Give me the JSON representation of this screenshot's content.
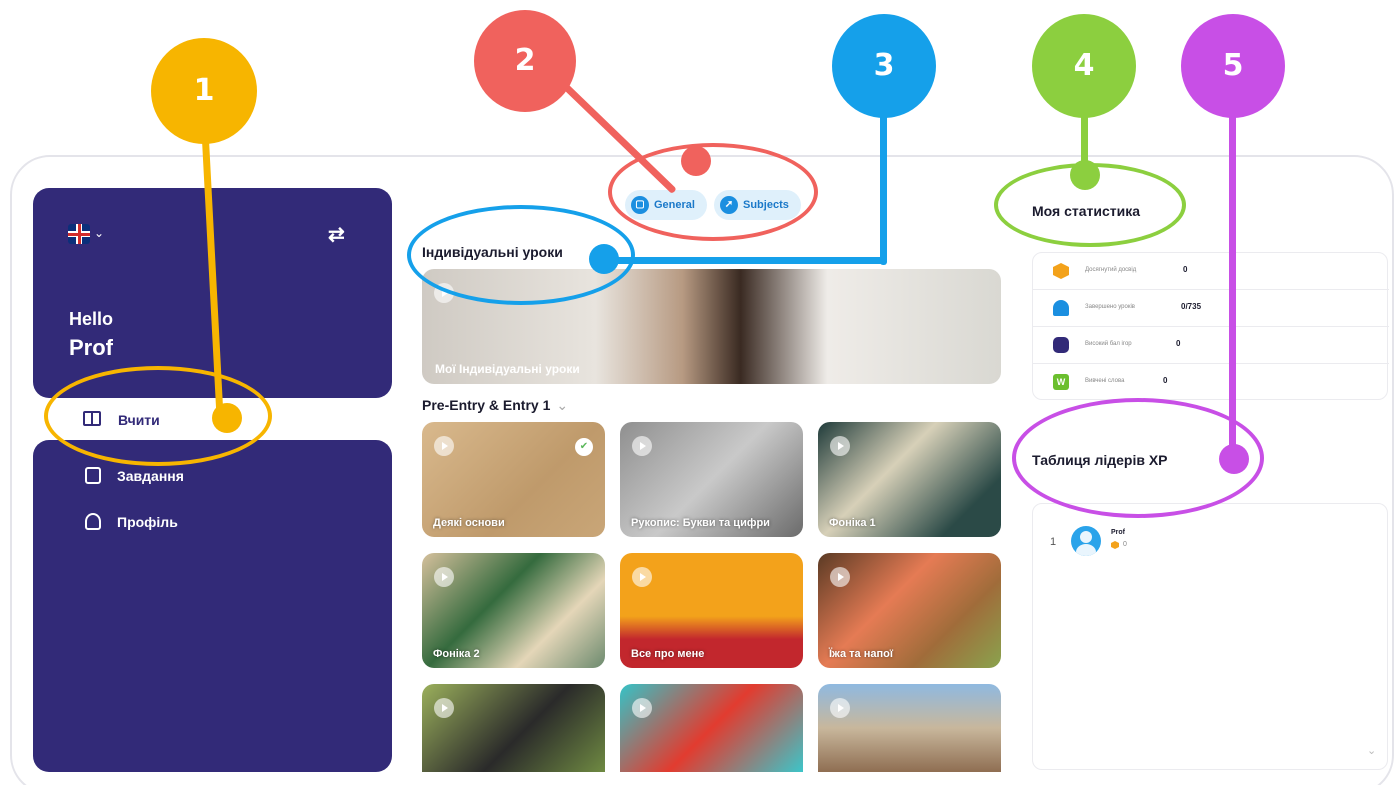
{
  "sidebar": {
    "hello": "Hello",
    "user_name": "Prof",
    "nav": [
      {
        "label": "Вчити",
        "active": true
      },
      {
        "label": "Завдання",
        "active": false
      },
      {
        "label": "Профіль",
        "active": false
      }
    ],
    "language_icon": "uk-flag-icon",
    "swap_icon": "swap-arrows-icon"
  },
  "tabs": [
    {
      "label": "General",
      "icon": "book-icon"
    },
    {
      "label": "Subjects",
      "icon": "rocket-icon"
    }
  ],
  "main": {
    "individual_title": "Індивідуальні уроки",
    "hero_label": "Мої Індивідуальні уроки",
    "level_title": "Pre-Entry & Entry 1",
    "lessons": [
      {
        "label": "Деякі основи",
        "completed": true
      },
      {
        "label": "Рукопис: Букви та цифри",
        "completed": false
      },
      {
        "label": "Фоніка 1",
        "completed": false
      },
      {
        "label": "Фоніка 2",
        "completed": false
      },
      {
        "label": "Все про мене",
        "completed": false
      },
      {
        "label": "Їжа та напої",
        "completed": false
      },
      {
        "label": "",
        "completed": false
      },
      {
        "label": "",
        "completed": false
      },
      {
        "label": "",
        "completed": false
      }
    ]
  },
  "stats": {
    "title": "Моя статистика",
    "rows": [
      {
        "icon": "xp-hexagon-icon",
        "label": "Досягнутий досвід",
        "value": "0"
      },
      {
        "icon": "bell-icon",
        "label": "Завершено уроків",
        "value": "0/735"
      },
      {
        "icon": "gamepad-icon",
        "label": "Високий бал ігор",
        "value": "0"
      },
      {
        "icon": "word-w-icon",
        "label": "Вивчені слова",
        "value": "0"
      }
    ]
  },
  "leaderboard": {
    "title": "Таблиця лідерів XP",
    "entries": [
      {
        "rank": "1",
        "name": "Prof",
        "xp": "0"
      }
    ]
  },
  "annotations": [
    {
      "number": "1",
      "color": "#f7b500"
    },
    {
      "number": "2",
      "color": "#f0625d"
    },
    {
      "number": "3",
      "color": "#15a0ea"
    },
    {
      "number": "4",
      "color": "#8ccf3f"
    },
    {
      "number": "5",
      "color": "#c84fe6"
    }
  ]
}
